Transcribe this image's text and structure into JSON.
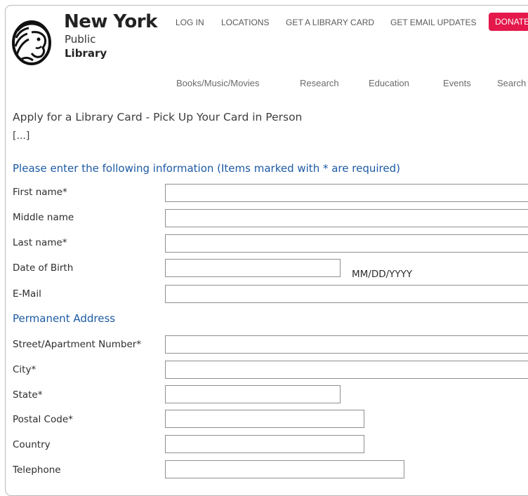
{
  "logo": {
    "icon": "nypl-lion-icon",
    "line1": "New York",
    "line2": "Public",
    "line3": "Library"
  },
  "utility_nav": [
    "LOG IN",
    "LOCATIONS",
    "GET A LIBRARY CARD",
    "GET EMAIL UPDATES"
  ],
  "donate_label": "DONATE",
  "main_nav": [
    "Books/Music/Movies",
    "Research",
    "Education",
    "Events",
    "Search"
  ],
  "page_title": "Apply for a Library Card - Pick Up Your Card in Person",
  "ellipsis": "[...]",
  "form": {
    "instructions": "Please enter the following information (Items marked with * are required)",
    "first_name": {
      "label": "First name*",
      "value": ""
    },
    "middle_name": {
      "label": "Middle name",
      "value": ""
    },
    "last_name": {
      "label": "Last name*",
      "value": ""
    },
    "dob": {
      "label": "Date of Birth",
      "value": "",
      "hint": "MM/DD/YYYY"
    },
    "email": {
      "label": "E-Mail",
      "value": ""
    },
    "address_heading": "Permanent Address",
    "street": {
      "label": "Street/Apartment Number*",
      "value": ""
    },
    "city": {
      "label": "City*",
      "value": ""
    },
    "state": {
      "label": "State*",
      "value": ""
    },
    "postal": {
      "label": "Postal Code*",
      "value": ""
    },
    "country": {
      "label": "Country",
      "value": ""
    },
    "telephone": {
      "label": "Telephone",
      "value": ""
    }
  },
  "colors": {
    "accent_blue": "#1d5aa4",
    "donate_red": "#e4184b",
    "border": "#8f8f8f"
  }
}
